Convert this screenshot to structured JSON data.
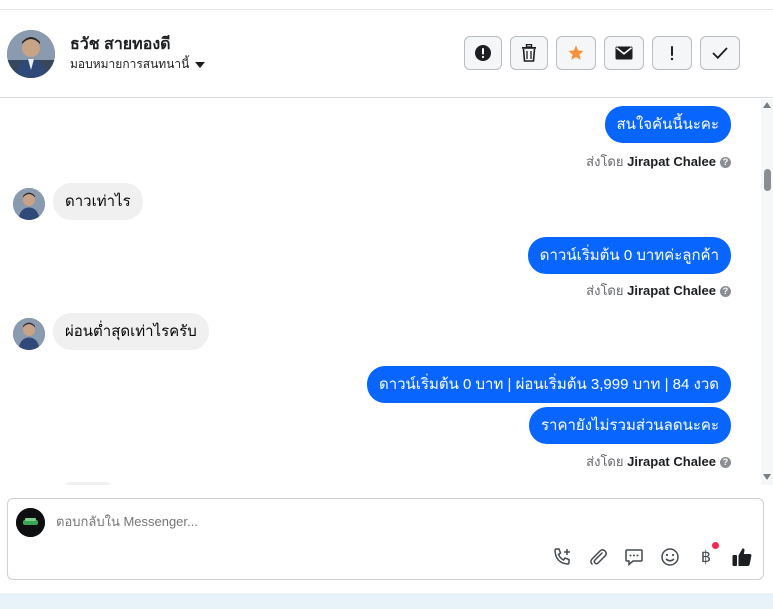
{
  "header": {
    "contact_name": "ธวัช สายทองดี",
    "assign_label": "มอบหมายการสนทนานี้"
  },
  "actions": [
    {
      "name": "spam-report-button",
      "icon": "alert-circle-icon"
    },
    {
      "name": "delete-button",
      "icon": "trash-icon"
    },
    {
      "name": "star-button",
      "icon": "star-icon"
    },
    {
      "name": "mark-unread-button",
      "icon": "envelope-icon"
    },
    {
      "name": "follow-up-button",
      "icon": "exclamation-icon"
    },
    {
      "name": "mark-done-button",
      "icon": "check-icon"
    }
  ],
  "colors": {
    "outgoing_bubble": "#0866ff",
    "incoming_bubble": "#f0f0f0",
    "star": "#f7923b"
  },
  "messages": {
    "m1": "สนใจคันนี้นะคะ",
    "m2": "ดาวเท่าไร",
    "m3": "ดาวน์เริ่มต้น 0 บาทค่ะลูกค้า",
    "m4": "ผ่อนต่ำสุดเท่าไรครับ",
    "m5": "ดาวน์เริ่มต้น 0 บาท | ผ่อนเริ่มต้น 3,999 บาท | 84 งวด",
    "m6": "ราคายังไม่รวมส่วนลดนะคะ"
  },
  "sent_by": {
    "prefix": "ส่งโดย",
    "agent": "Jirapat Chalee"
  },
  "composer": {
    "placeholder": "ตอบกลับใน Messenger..."
  },
  "tools": {
    "currency_symbol": "฿"
  }
}
